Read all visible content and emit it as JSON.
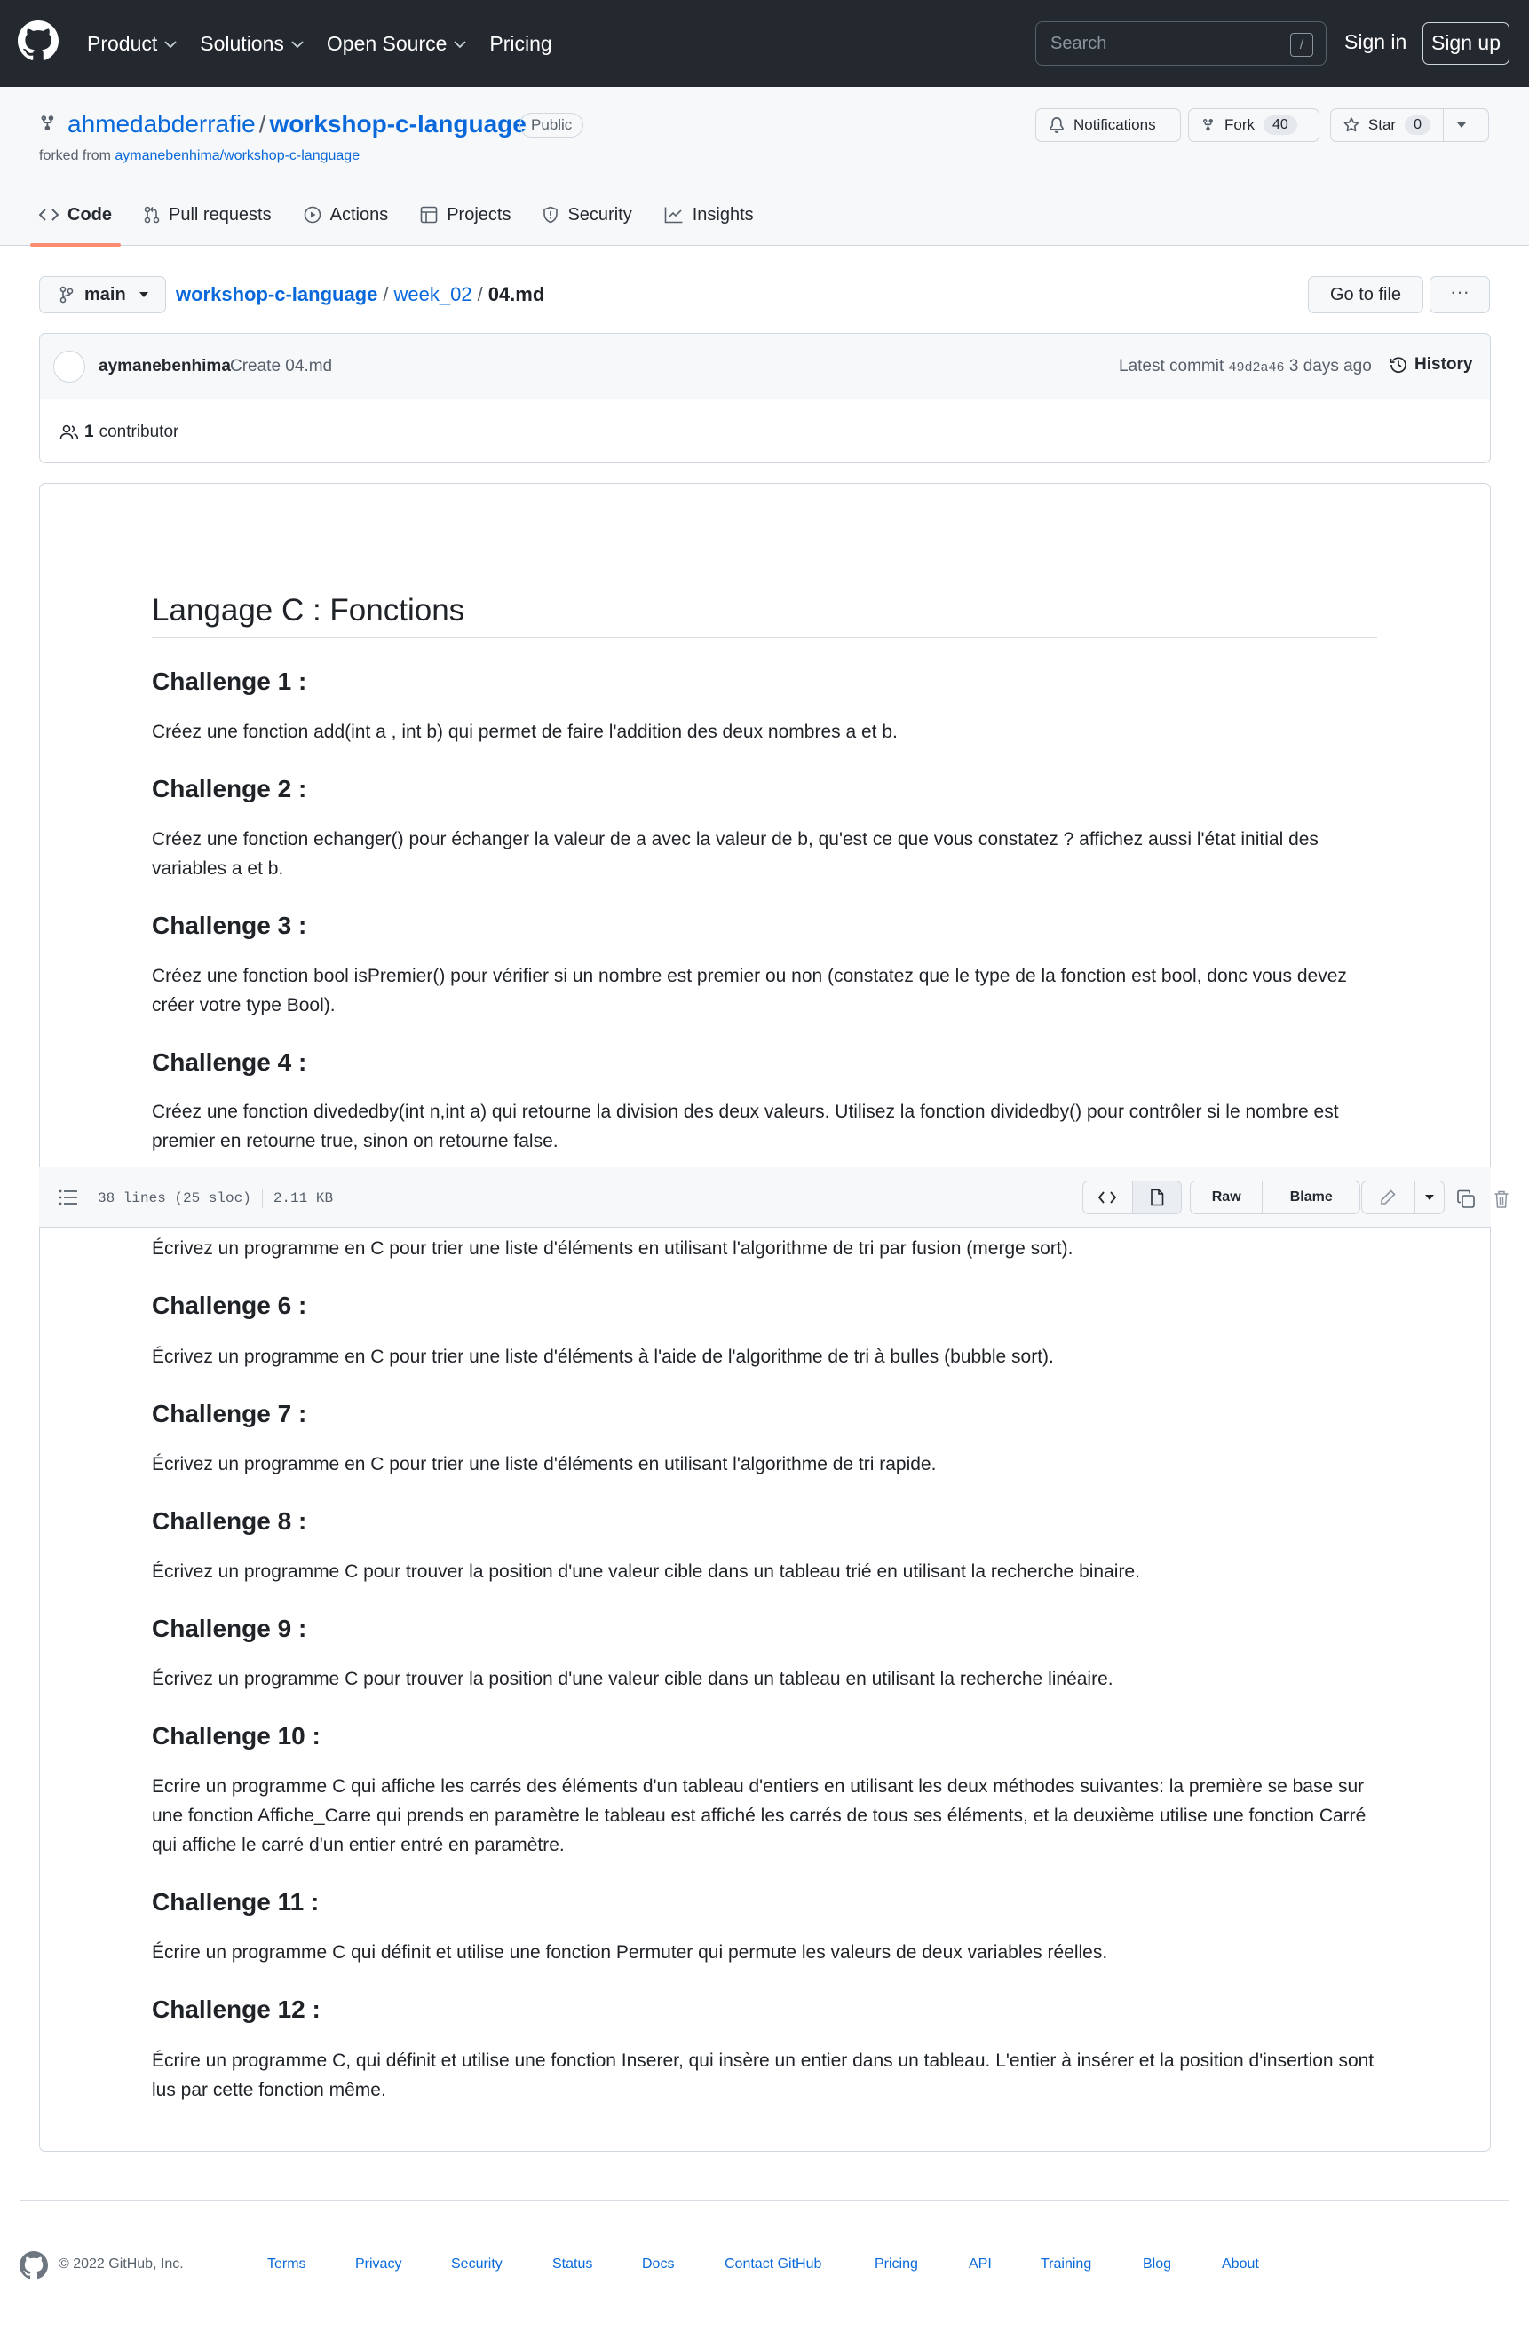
{
  "header": {
    "nav": [
      "Product",
      "Solutions",
      "Open Source",
      "Pricing"
    ],
    "search_placeholder": "Search",
    "search_shortcut": "/",
    "sign_in": "Sign in",
    "sign_up": "Sign up"
  },
  "repo": {
    "owner": "ahmedabderrafie",
    "separator": "/",
    "name": "workshop-c-language",
    "visibility": "Public",
    "forked_from_prefix": "forked from",
    "forked_from": "aymanebenhima/workshop-c-language",
    "notifications_label": "Notifications",
    "fork_label": "Fork",
    "fork_count": "40",
    "star_label": "Star",
    "star_count": "0",
    "tabs": [
      "Code",
      "Pull requests",
      "Actions",
      "Projects",
      "Security",
      "Insights"
    ]
  },
  "file_nav": {
    "branch": "main",
    "crumb_repo": "workshop-c-language",
    "crumb_sep": "/",
    "crumb_folder": "week_02",
    "crumb_file": "04.md",
    "goto_file": "Go to file",
    "more": "···"
  },
  "commit": {
    "author": "aymanebenhima",
    "message": "Create 04.md",
    "latest_label": "Latest commit",
    "sha": "49d2a46",
    "when": "3 days ago",
    "history": "History",
    "contributors_count": "1",
    "contributors_label": "contributor"
  },
  "file_header": {
    "lines": "38 lines (25 sloc)",
    "size": "2.11 KB",
    "raw": "Raw",
    "blame": "Blame"
  },
  "markdown": {
    "title": "Langage C : Fonctions",
    "sections": [
      {
        "heading": "Challenge 1 :",
        "text": "Créez une fonction add(int a , int b) qui permet de faire l'addition des deux nombres a et b."
      },
      {
        "heading": "Challenge 2 :",
        "text": "Créez une fonction echanger() pour échanger la valeur de a avec la valeur de b, qu'est ce que vous constatez ? affichez aussi l'état initial des variables a et b."
      },
      {
        "heading": "Challenge 3 :",
        "text": "Créez une fonction bool isPremier() pour vérifier si un nombre est premier ou non (constatez que le type de la fonction est bool, donc vous devez créer votre type Bool)."
      },
      {
        "heading": "Challenge 4 :",
        "text": "Créez une fonction divededby(int n,int a) qui retourne la division des deux valeurs. Utilisez la fonction dividedby() pour contrôler si le nombre est premier en retourne true, sinon on retourne false."
      },
      {
        "heading": "",
        "text": "Écrivez un programme en C pour trier une liste d'éléments en utilisant l'algorithme de tri par fusion (merge sort)."
      },
      {
        "heading": "Challenge 6 :",
        "text": "Écrivez un programme en C pour trier une liste d'éléments à l'aide de l'algorithme de tri à bulles (bubble sort)."
      },
      {
        "heading": "Challenge 7 :",
        "text": "Écrivez un programme en C pour trier une liste d'éléments en utilisant l'algorithme de tri rapide."
      },
      {
        "heading": "Challenge 8 :",
        "text": "Écrivez un programme C pour trouver la position d'une valeur cible dans un tableau trié en utilisant la recherche binaire."
      },
      {
        "heading": "Challenge 9 :",
        "text": "Écrivez un programme C pour trouver la position d'une valeur cible dans un tableau en utilisant la recherche linéaire."
      },
      {
        "heading": "Challenge 10 :",
        "text": "Ecrire un programme C qui affiche les carrés des éléments d'un tableau d'entiers en utilisant les deux méthodes suivantes: la première se base sur une fonction Affiche_Carre qui prends en paramètre le tableau est affiché les carrés de tous ses éléments, et la deuxième utilise une fonction Carré qui affiche le carré d'un entier entré en paramètre."
      },
      {
        "heading": "Challenge 11 :",
        "text": "Écrire un programme C qui définit et utilise une fonction Permuter qui permute les valeurs de deux variables réelles."
      },
      {
        "heading": "Challenge 12 :",
        "text": "Écrire un programme C, qui définit et utilise une fonction Inserer, qui insère un entier dans un tableau. L'entier à insérer et la position d'insertion sont lus par cette fonction même."
      }
    ]
  },
  "footer": {
    "copyright": "© 2022 GitHub, Inc.",
    "links": [
      "Terms",
      "Privacy",
      "Security",
      "Status",
      "Docs",
      "Contact GitHub",
      "Pricing",
      "API",
      "Training",
      "Blog",
      "About"
    ]
  },
  "colors": {
    "header_bg": "#24292f",
    "link": "#0969da",
    "tab_underline": "#fd8c73",
    "border": "#d0d7de",
    "muted": "#57606a"
  }
}
